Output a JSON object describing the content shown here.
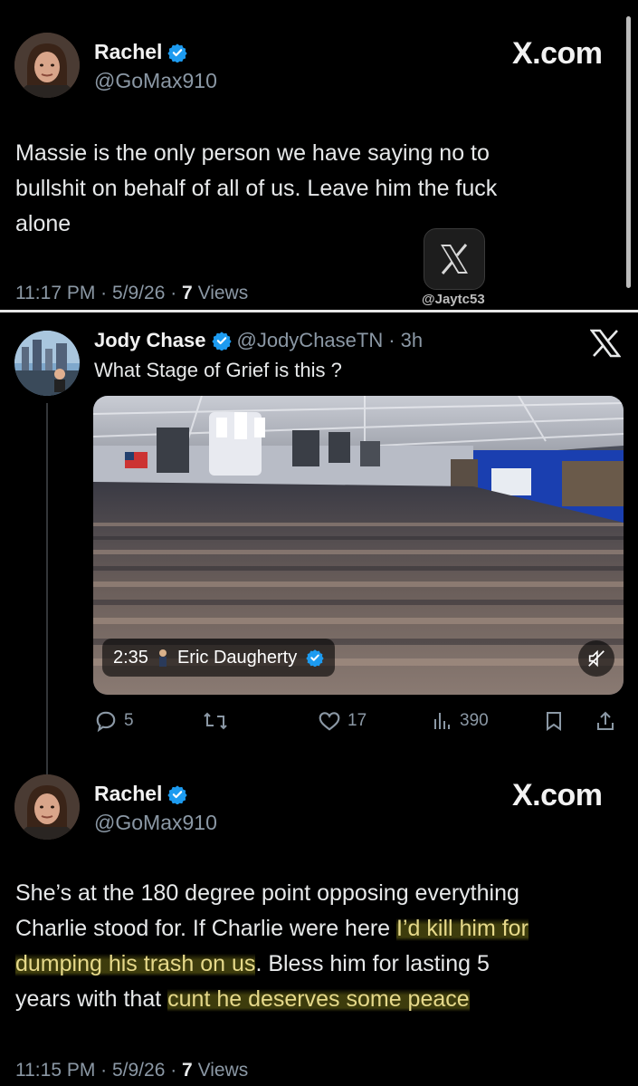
{
  "post1": {
    "name": "Rachel",
    "handle": "@GoMax910",
    "brand": "X.com",
    "text_lines": [
      "Massie is the only person we have saying no to",
      "bullshit on behalf of all of us. Leave him the fuck",
      "alone"
    ],
    "time": "11:17 PM · 5/9/26 · ",
    "views_count": "7",
    "views_label": " Views",
    "watermark": "@Jaytc53"
  },
  "quote": {
    "name": "Jody Chase",
    "handle": "@JodyChaseTN",
    "age": "· 3h",
    "text": "What Stage of Grief is this ?",
    "media": {
      "duration": "2:35",
      "author": "Eric Daugherty"
    },
    "actions": {
      "replies": "5",
      "likes": "17",
      "views": "390"
    }
  },
  "post2": {
    "name": "Rachel",
    "handle": "@GoMax910",
    "brand": "X.com",
    "line1": "She’s at the 180 degree point opposing everything",
    "line2_plain": "Charlie stood for. If Charlie were here ",
    "line2_hl": "I’d kill him for",
    "line3_hl": "dumping his trash on us",
    "line3_plain": ". Bless him for lasting 5",
    "line4_plain": "years with that ",
    "line4_hl": "cunt he deserves some peace",
    "time": "11:15 PM · 5/9/26 · ",
    "views_count": "7",
    "views_label": " Views"
  },
  "colors": {
    "background": "#000000",
    "verified": "#1d9bf0",
    "secondary_text": "#8b98a5",
    "highlight": "#e6d98a"
  },
  "icons": [
    "verified-badge-icon",
    "x-logo-icon",
    "reply-icon",
    "repost-icon",
    "like-icon",
    "views-icon",
    "bookmark-icon",
    "share-icon",
    "mute-icon"
  ]
}
